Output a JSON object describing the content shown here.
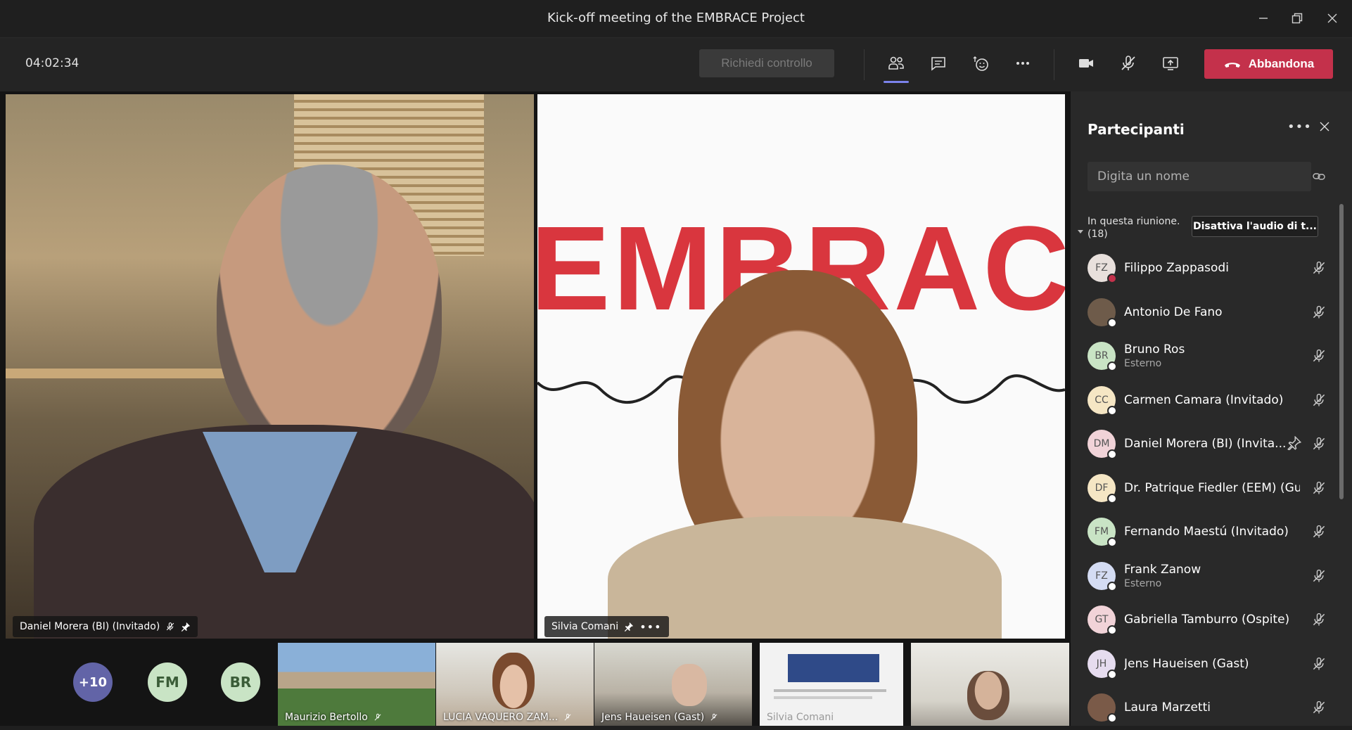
{
  "window": {
    "title": "Kick-off meeting of the EMBRACE Project",
    "controls": [
      "minimize-icon",
      "restore-icon",
      "close-icon"
    ]
  },
  "toolbar": {
    "timer": "04:02:34",
    "request_control_label": "Richiedi controllo",
    "leave_label": "Abbandona",
    "icons": [
      "participants-icon",
      "chat-icon",
      "reactions-icon",
      "more-icon",
      "camera-icon",
      "mic-off-icon",
      "share-icon"
    ]
  },
  "stage": {
    "main_videos": [
      {
        "name": "Daniel Morera (BI) (Invitado)"
      },
      {
        "name": "Silvia Comani",
        "backdrop_text": "EMBRACE"
      }
    ],
    "overflow_count": "+10",
    "avatar_thumbs": [
      {
        "initials": "FM",
        "color": "#c9e4c5"
      },
      {
        "initials": "BR",
        "color": "#c9e4c5"
      }
    ],
    "video_thumbs": [
      {
        "name": "Maurizio Bertollo"
      },
      {
        "name": "LUCIA VAQUERO ZAM..."
      },
      {
        "name": "Jens Haueisen (Gast)"
      },
      {
        "name": "Silvia Comani"
      },
      {
        "name": ""
      }
    ]
  },
  "panel": {
    "title": "Partecipanti",
    "search_placeholder": "Digita un nome",
    "section_label": "In questa riunione.",
    "section_count": "(18)",
    "mute_all_label": "Disattiva l'audio di t...",
    "participants": [
      {
        "initials": "FZ",
        "name": "Filippo Zappasodi",
        "sub": "",
        "bg": "#e8e0dc",
        "status": "red"
      },
      {
        "initials": "",
        "name": "Antonio De Fano",
        "sub": "",
        "bg": "#6e5b4a",
        "status": "white"
      },
      {
        "initials": "BR",
        "name": "Bruno Ros",
        "sub": "Esterno",
        "bg": "#c9e4c5",
        "status": "white"
      },
      {
        "initials": "CC",
        "name": "Carmen Camara (Invitado)",
        "sub": "",
        "bg": "#f5e6c4",
        "status": "white"
      },
      {
        "initials": "DM",
        "name": "Daniel Morera (BI) (Invita...",
        "sub": "",
        "bg": "#f1d3d8",
        "status": "white",
        "pinned": true
      },
      {
        "initials": "DF",
        "name": "Dr. Patrique Fiedler (EEM) (Gu...",
        "sub": "",
        "bg": "#f5e6c4",
        "status": "white"
      },
      {
        "initials": "FM",
        "name": "Fernando Maestú (Invitado)",
        "sub": "",
        "bg": "#c9e4c5",
        "status": "white"
      },
      {
        "initials": "FZ",
        "name": "Frank Zanow",
        "sub": "Esterno",
        "bg": "#d4dcf3",
        "status": "white"
      },
      {
        "initials": "GT",
        "name": "Gabriella Tamburro (Ospite)",
        "sub": "",
        "bg": "#f1d3d8",
        "status": "white"
      },
      {
        "initials": "JH",
        "name": "Jens Haueisen (Gast)",
        "sub": "",
        "bg": "#e6dcef",
        "status": "white"
      },
      {
        "initials": "",
        "name": "Laura Marzetti",
        "sub": "",
        "bg": "#7a5a48",
        "status": "white"
      }
    ]
  },
  "colors": {
    "accent": "#7b83eb",
    "leave": "#c4314b",
    "embrace_red": "#d9363e"
  }
}
